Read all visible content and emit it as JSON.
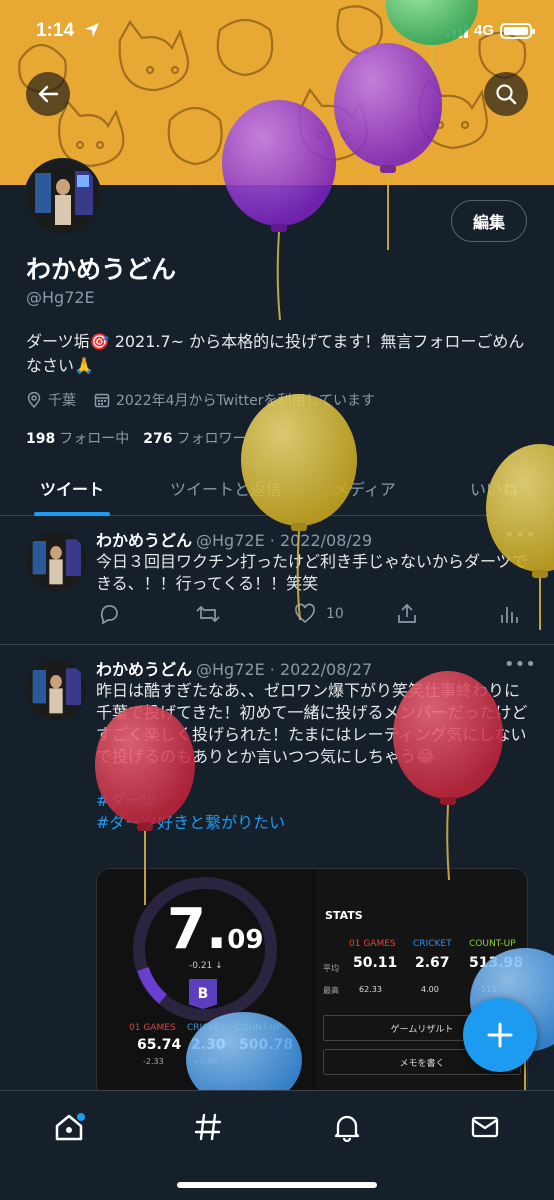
{
  "status_bar": {
    "time": "1:14",
    "network": "4G"
  },
  "profile": {
    "edit_label": "編集",
    "display_name": "わかめうどん",
    "handle": "@Hg72E",
    "bio": "ダーツ垢🎯 2021.7~ から本格的に投げてます！無言フォローごめんなさい🙏",
    "location": "千葉",
    "joined": "2022年4月からTwitterを利用しています",
    "following_count": "198",
    "following_label": "フォロー中",
    "followers_count": "276",
    "followers_label": "フォロワー"
  },
  "tabs": [
    {
      "label": "ツイート"
    },
    {
      "label": "ツイートと返信"
    },
    {
      "label": "メディア"
    },
    {
      "label": "いいね"
    }
  ],
  "tweets": [
    {
      "name": "わかめうどん",
      "handle": "@Hg72E",
      "date": "2022/08/29",
      "text": "今日３回目ワクチン打ったけど利き手じゃないからダーツできる、！！行ってくる！！笑笑",
      "likes": "10"
    },
    {
      "name": "わかめうどん",
      "handle": "@Hg72E",
      "date": "2022/08/27",
      "text": "昨日は酷すぎたなあ、、ゼロワン爆下がり笑笑仕事終わりに千葉で投げてきた！初めて一緒に投げるメンバーだったけどすごく楽しく投げられた！たまにはレーティング気にしないで投げるのもありとか言いつつ気にしちゃう😂",
      "hashtag1": "#ダーツ",
      "hashtag2": "#ダーツ好きと繋がりたい"
    }
  ],
  "card": {
    "rating_main": "7.",
    "rating_decimal": "09",
    "delta": "-0.21 ↓",
    "flight": "B",
    "games_left": [
      {
        "label": "01 GAMES",
        "value": "65.74",
        "sub": "-2.33",
        "color": "#e0453a"
      },
      {
        "label": "CRICKET",
        "value": "2.30",
        "sub": "+0.06",
        "color": "#3a8ee0"
      },
      {
        "label": "COUNT-UP",
        "value": "500.78",
        "sub": "",
        "color": "#8fcf3a"
      }
    ],
    "stats_title": "STATS",
    "stats_headers": [
      "01 GAMES",
      "CRICKET",
      "COUNT-UP"
    ],
    "row_avg_label": "平均",
    "row_max_label": "最高",
    "stats_avg": [
      "50.11",
      "2.67",
      "513.98"
    ],
    "stats_max": [
      "62.33",
      "4.00",
      "513"
    ],
    "menu": [
      "ゲームリザルト",
      "メモを書く"
    ]
  },
  "colors": {
    "background": "#15202b",
    "accent": "#1d9bf0",
    "banner": "#e8a934"
  }
}
